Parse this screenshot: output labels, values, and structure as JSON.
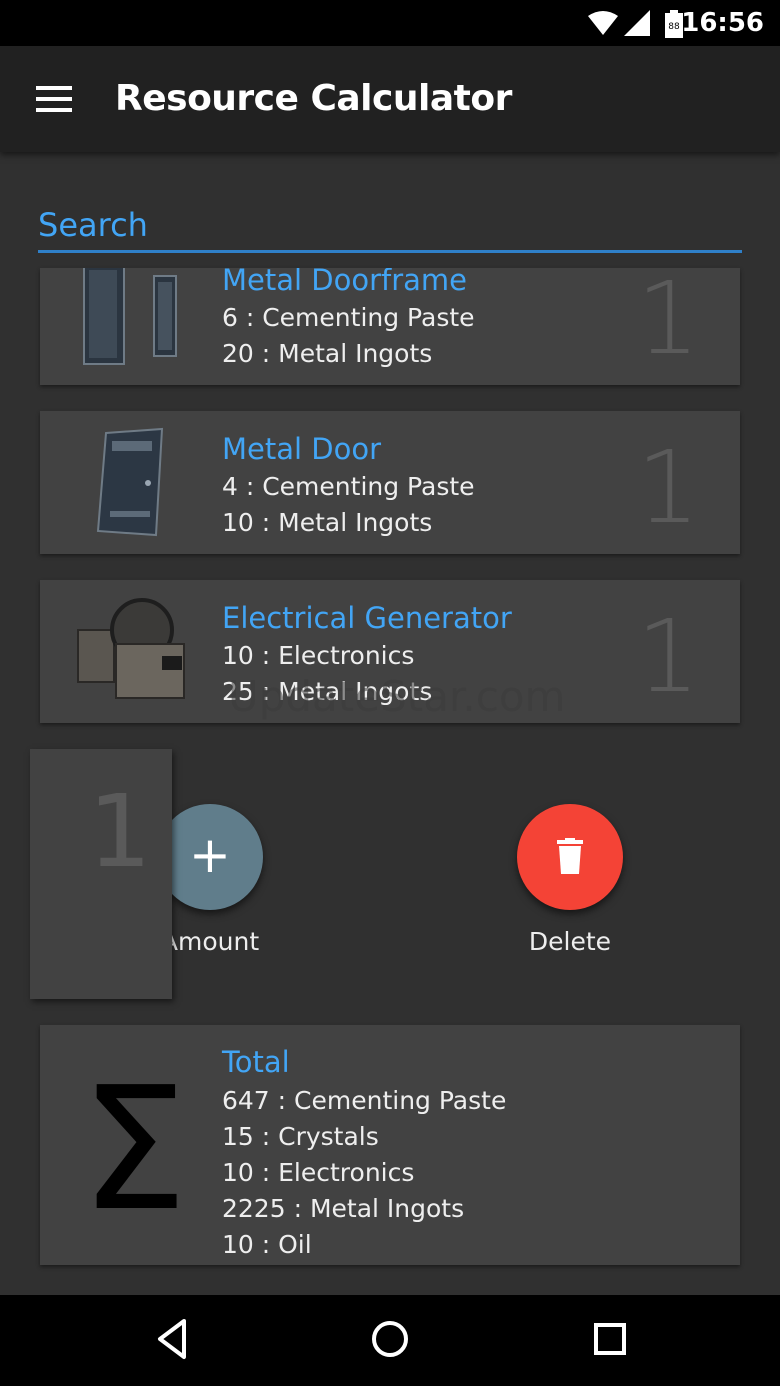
{
  "status_bar": {
    "battery_level": "88",
    "time": "16:56"
  },
  "toolbar": {
    "menu_icon": "hamburger-menu-icon",
    "title": "Resource Calculator"
  },
  "search": {
    "placeholder": "Search"
  },
  "items": [
    {
      "name": "Metal Doorframe",
      "lines": [
        "6 : Cementing Paste",
        "20 : Metal Ingots"
      ],
      "qty": "1",
      "thumb_icon": "metal-doorframe-icon"
    },
    {
      "name": "Metal Door",
      "lines": [
        "4 : Cementing Paste",
        "10 : Metal Ingots"
      ],
      "qty": "1",
      "thumb_icon": "metal-door-icon"
    },
    {
      "name": "Electrical Generator",
      "lines": [
        "10 : Electronics",
        "25 : Metal Ingots"
      ],
      "qty": "1",
      "thumb_icon": "electrical-generator-icon"
    }
  ],
  "editor": {
    "qty": "1",
    "add_label": "Amount",
    "add_icon": "plus-icon",
    "delete_label": "Delete",
    "delete_icon": "trash-icon",
    "add_color": "#607d8b",
    "delete_color": "#f44336"
  },
  "watermark": "UpdateStar.com",
  "total": {
    "title": "Total",
    "icon": "sigma-icon",
    "lines": [
      "647 : Cementing Paste",
      "15 : Crystals",
      "10 : Electronics",
      "2225 : Metal Ingots",
      "10 : Oil"
    ]
  },
  "nav": {
    "back_icon": "back-icon",
    "home_icon": "home-icon",
    "recents_icon": "recents-icon"
  },
  "colors": {
    "accent": "#42a5f5",
    "background": "#303030",
    "card": "#424242",
    "toolbar": "#212121"
  }
}
